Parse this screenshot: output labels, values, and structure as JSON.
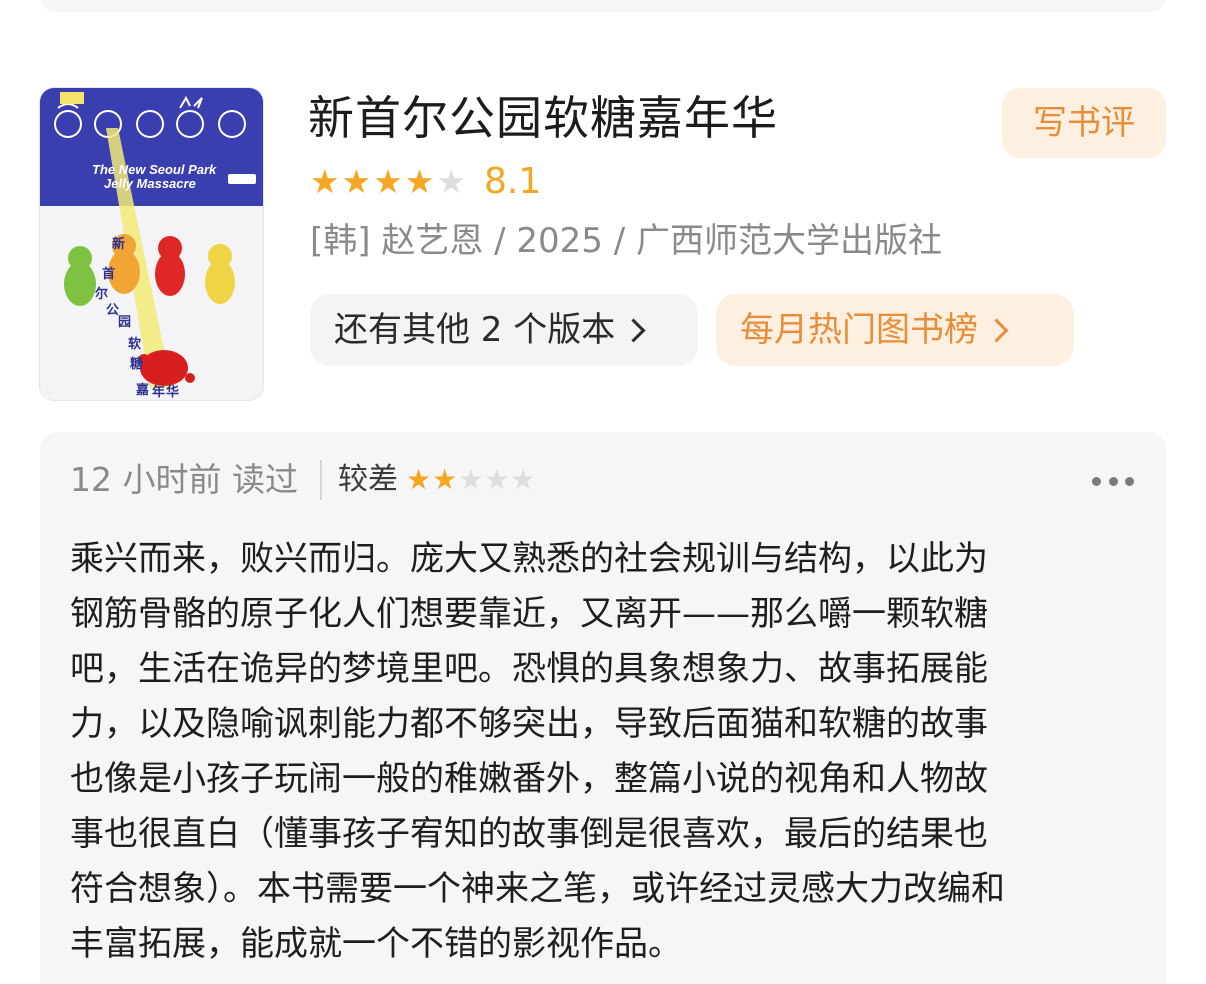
{
  "book": {
    "title": "新首尔公园软糖嘉年华",
    "rating_value": 8.1,
    "rating_stars": 4,
    "rating_stars_max": 5,
    "meta": "[韩] 赵艺恩 / 2025 / 广西师范大学出版社",
    "write_review_label": "写书评",
    "other_versions_label": "还有其他 2 个版本",
    "monthly_chart_label": "每月热门图书榜",
    "cover": {
      "english_title_line1": "The New Seoul Park",
      "english_title_line2": "Jelly Massacre",
      "cn_title_chars": [
        "新",
        "首",
        "尔",
        "公",
        "园",
        "软",
        "糖",
        "嘉",
        "年",
        "华"
      ],
      "cover_band_color": "#3a3fb0",
      "icon": "book-cover-image"
    }
  },
  "review": {
    "time": "12 小时前 读过",
    "grade_label": "较差",
    "stars": 2,
    "stars_max": 5,
    "more_icon": "more-dots-icon",
    "lines": [
      "乘兴而来，败兴而归。庞大又熟悉的社会规训与结构，以此为",
      "钢筋骨骼的原子化人们想要靠近，又离开——那么嚼一颗软糖",
      "吧，生活在诡异的梦境里吧。恐惧的具象想象力、故事拓展能",
      "力，以及隐喻讽刺能力都不够突出，导致后面猫和软糖的故事",
      "也像是小孩子玩闹一般的稚嫩番外，整篇小说的视角和人物故",
      "事也很直白（懂事孩子宥知的故事倒是很喜欢，最后的结果也",
      "符合想象）。本书需要一个神来之笔，或许经过灵感大力改编和",
      "丰富拓展，能成就一个不错的影视作品。"
    ]
  },
  "colors": {
    "accent_orange": "#f5a623",
    "accent_orange_text": "#e88e3a",
    "accent_orange_bg": "#fdf0e0",
    "card_bg": "#f6f6f6",
    "muted_text": "#8a8a8e"
  }
}
